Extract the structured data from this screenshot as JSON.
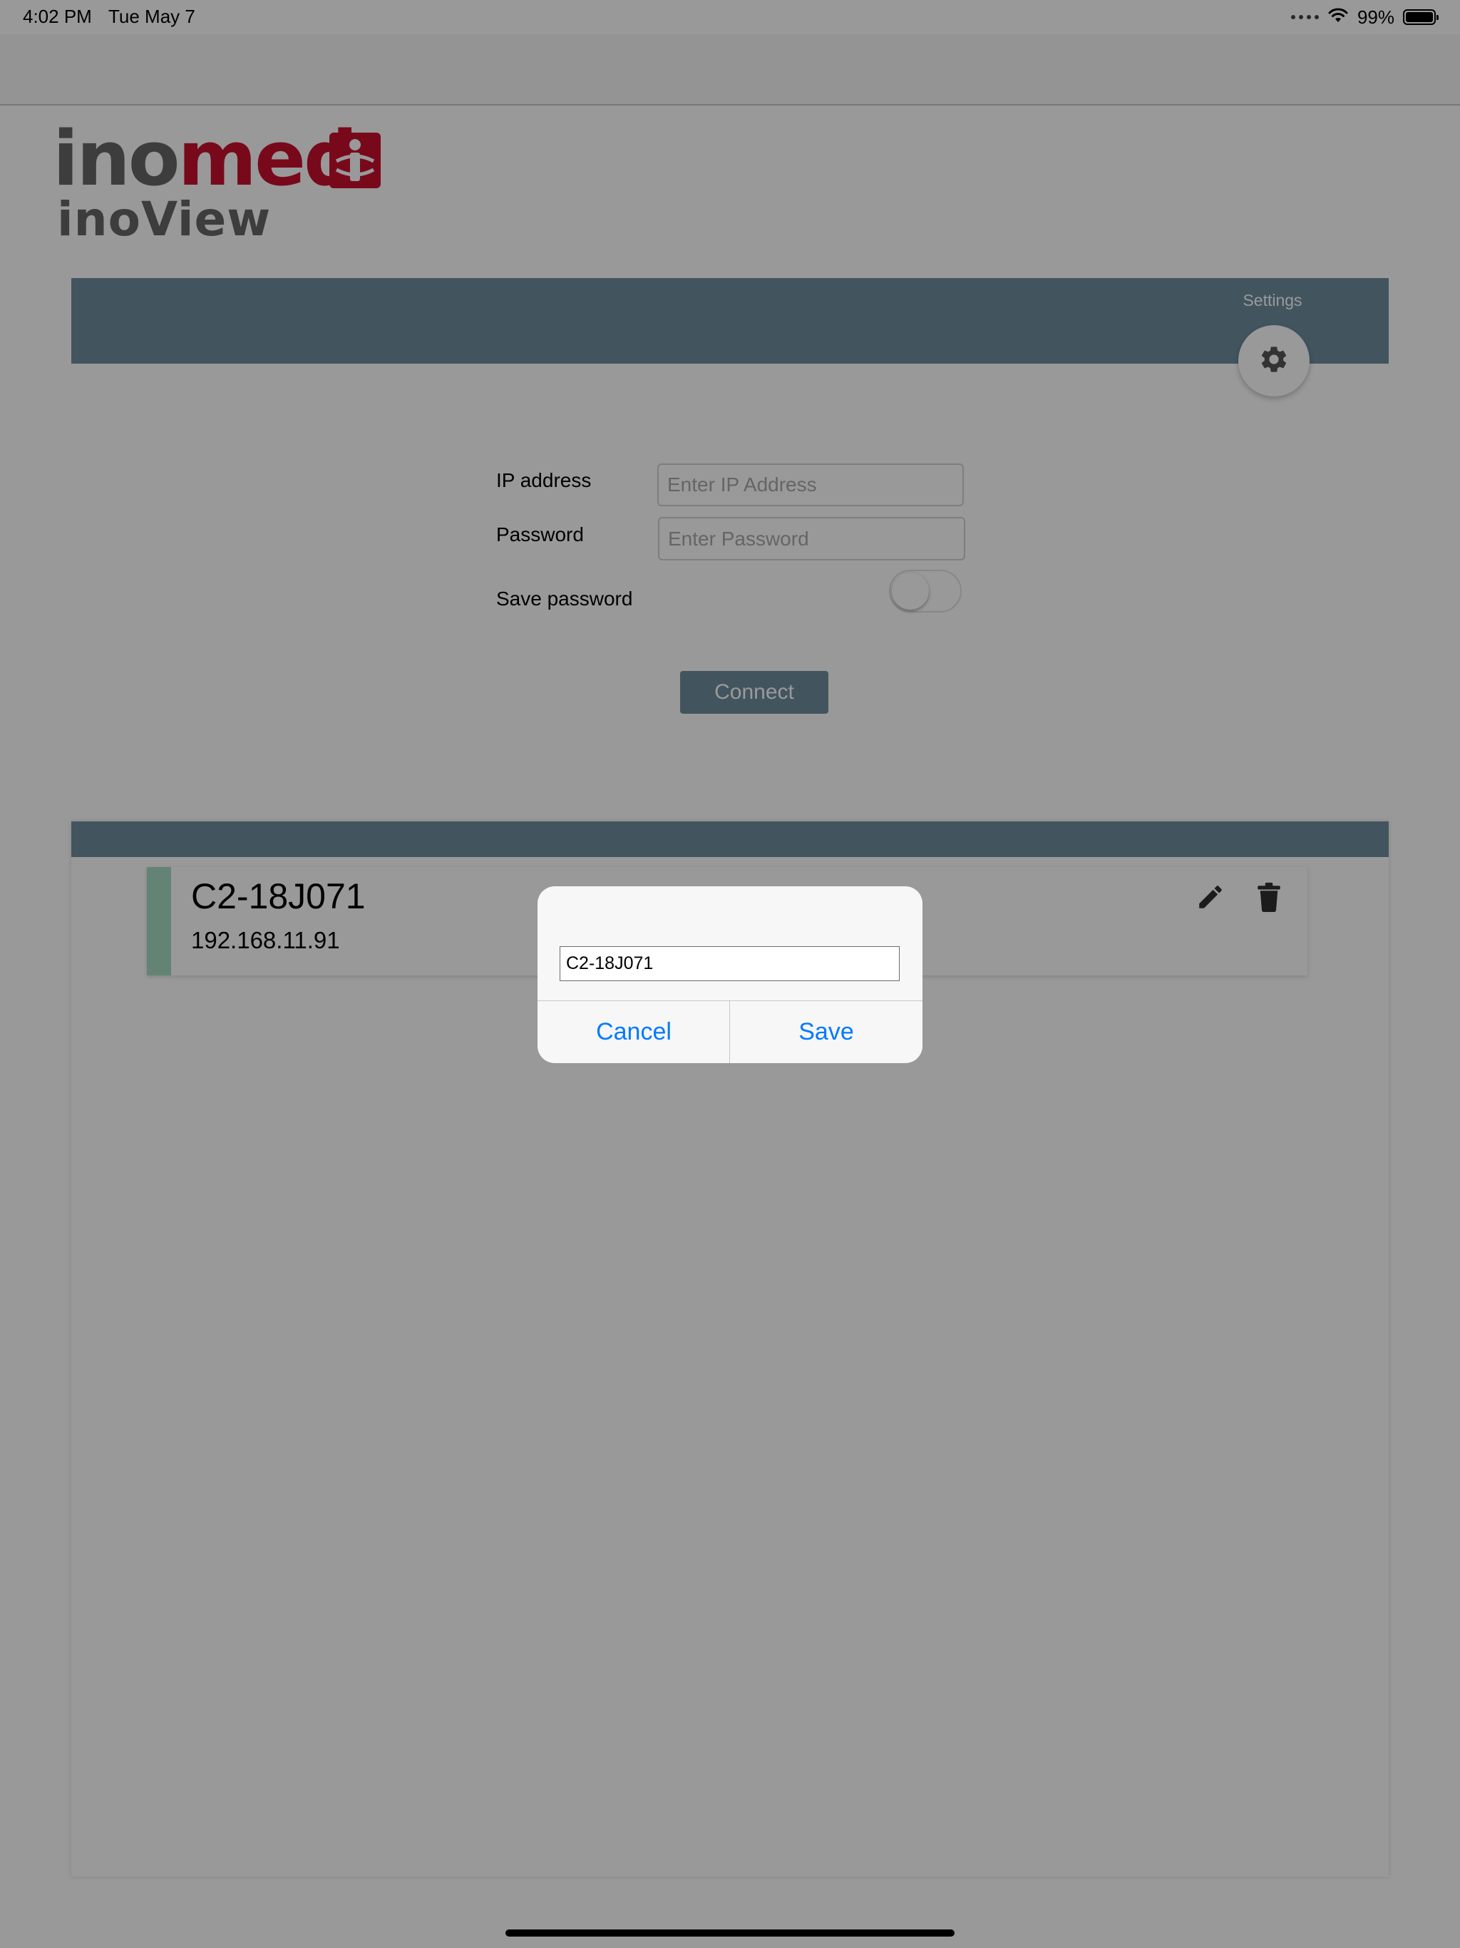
{
  "status_bar": {
    "time": "4:02 PM",
    "date": "Tue May 7",
    "battery": "99%",
    "icons": [
      "cellular-dots-icon",
      "wifi-icon",
      "battery-icon"
    ]
  },
  "brand": {
    "logo_part1": "ino",
    "logo_part2": "med",
    "app_name": "inoView"
  },
  "header": {
    "settings_label": "Settings",
    "settings_icon": "gear-icon"
  },
  "connect_form": {
    "ip_label": "IP address",
    "ip_value": "",
    "ip_placeholder": "Enter IP Address",
    "password_label": "Password",
    "password_value": "",
    "password_placeholder": "Enter Password",
    "save_password_label": "Save password",
    "save_password_on": false,
    "connect_label": "Connect"
  },
  "devices": [
    {
      "name": "C2-18J071",
      "ip": "192.168.11.91"
    }
  ],
  "rename_dialog": {
    "input_value": "C2-18J071",
    "cancel_label": "Cancel",
    "save_label": "Save"
  },
  "colors": {
    "header": "#6f8e9f",
    "device_accent": "#a6dcc2",
    "brand_red": "#c8102e",
    "ios_blue": "#007aff"
  }
}
